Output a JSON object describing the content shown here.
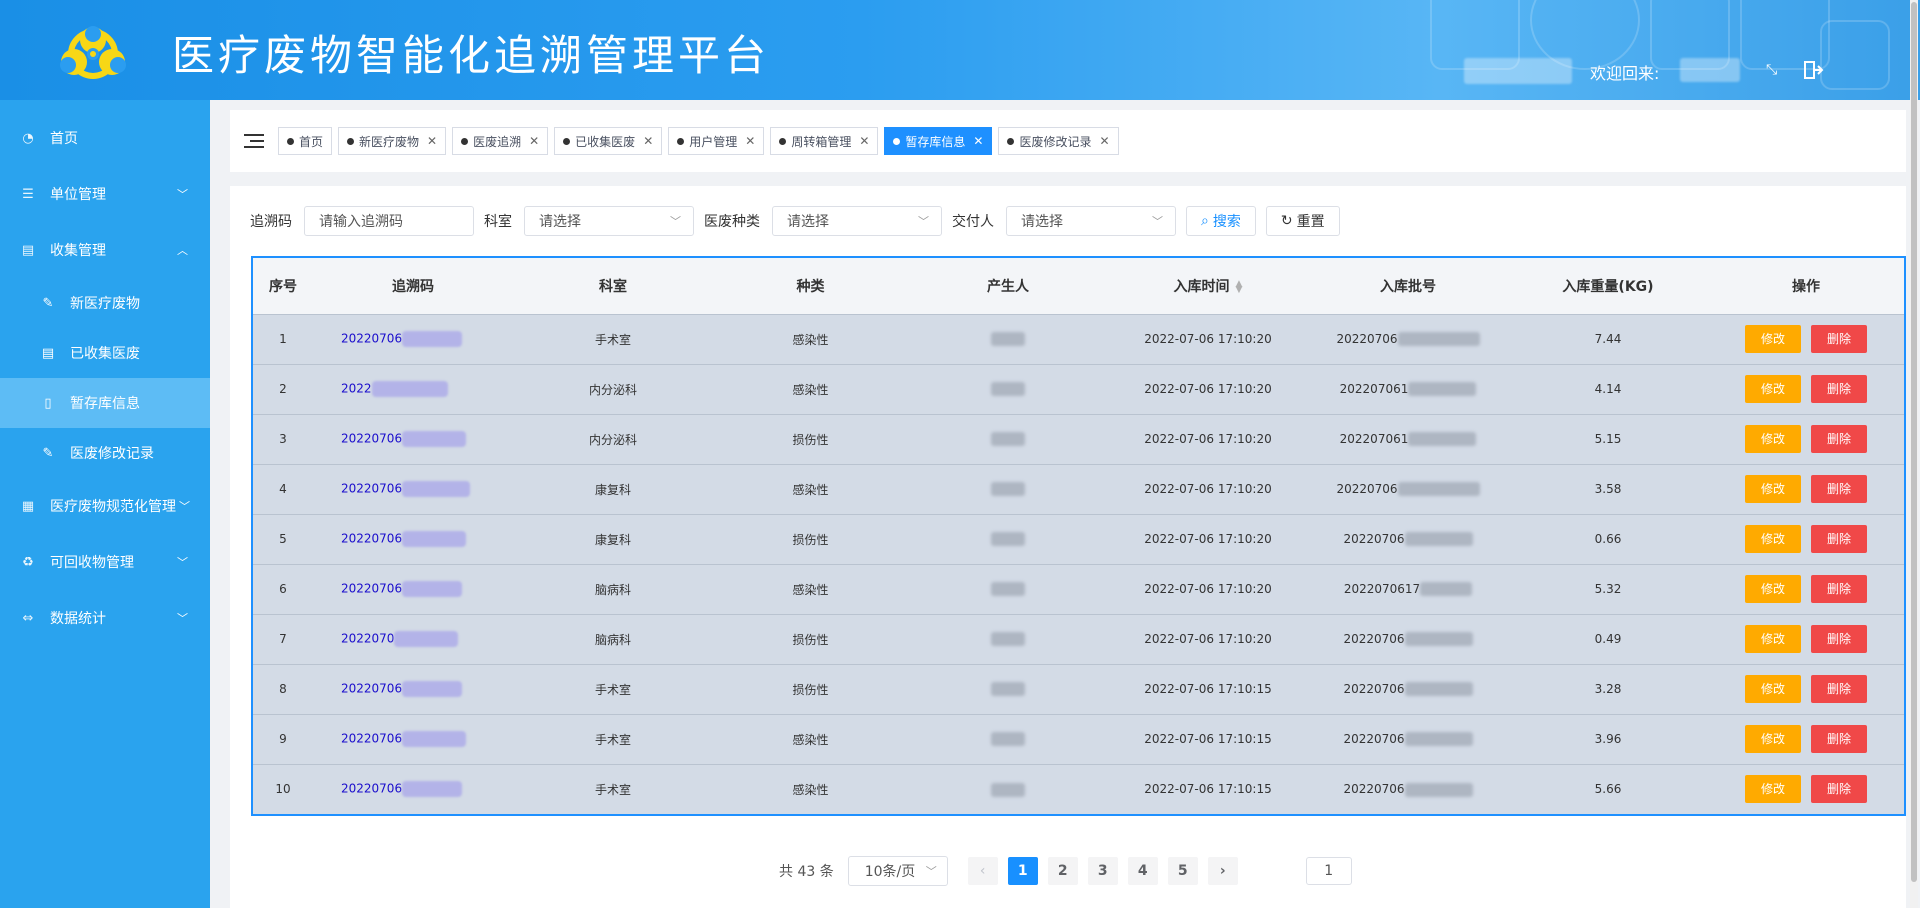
{
  "header": {
    "title": "医疗废物智能化追溯管理平台",
    "welcome": "欢迎回来:"
  },
  "sidebar": {
    "items": [
      {
        "label": "首页",
        "icon": "dashboard-icon"
      },
      {
        "label": "单位管理",
        "icon": "list-icon"
      },
      {
        "label": "收集管理",
        "icon": "box-icon"
      },
      {
        "label": "医疗废物规范化管理",
        "icon": "grid-icon"
      },
      {
        "label": "可回收物管理",
        "icon": "recycle-icon"
      },
      {
        "label": "数据统计",
        "icon": "chart-icon"
      }
    ],
    "sub_items": [
      {
        "label": "新医疗废物",
        "icon": "edit-icon"
      },
      {
        "label": "已收集医废",
        "icon": "box-icon"
      },
      {
        "label": "暂存库信息",
        "icon": "book-icon"
      },
      {
        "label": "医废修改记录",
        "icon": "edit-icon"
      }
    ]
  },
  "tabs": [
    {
      "label": "首页",
      "closable": false
    },
    {
      "label": "新医疗废物",
      "closable": true
    },
    {
      "label": "医废追溯",
      "closable": true
    },
    {
      "label": "已收集医废",
      "closable": true
    },
    {
      "label": "用户管理",
      "closable": true
    },
    {
      "label": "周转箱管理",
      "closable": true
    },
    {
      "label": "暂存库信息",
      "closable": true,
      "active": true
    },
    {
      "label": "医废修改记录",
      "closable": true
    }
  ],
  "filters": {
    "trace_label": "追溯码",
    "trace_placeholder": "请输入追溯码",
    "dept_label": "科室",
    "dept_value": "请选择",
    "type_label": "医废种类",
    "type_value": "请选择",
    "deliverer_label": "交付人",
    "deliverer_value": "请选择",
    "search_label": "搜索",
    "reset_label": "重置"
  },
  "table": {
    "headers": [
      "序号",
      "追溯码",
      "科室",
      "种类",
      "产生人",
      "入库时间",
      "入库批号",
      "入库重量(KG)",
      "操作"
    ],
    "edit_label": "修改",
    "delete_label": "删除",
    "rows": [
      {
        "no": "1",
        "code": "20220706",
        "dept": "手术室",
        "type": "感染性",
        "time": "2022-07-06 17:10:20",
        "batch": "20220706",
        "weight": "7.44"
      },
      {
        "no": "2",
        "code": "2022",
        "dept": "内分泌科",
        "type": "感染性",
        "time": "2022-07-06 17:10:20",
        "batch": "202207061",
        "weight": "4.14"
      },
      {
        "no": "3",
        "code": "20220706",
        "dept": "内分泌科",
        "type": "损伤性",
        "time": "2022-07-06 17:10:20",
        "batch": "202207061",
        "weight": "5.15"
      },
      {
        "no": "4",
        "code": "20220706",
        "dept": "康复科",
        "type": "感染性",
        "time": "2022-07-06 17:10:20",
        "batch": "20220706",
        "weight": "3.58"
      },
      {
        "no": "5",
        "code": "20220706",
        "dept": "康复科",
        "type": "损伤性",
        "time": "2022-07-06 17:10:20",
        "batch": "20220706",
        "weight": "0.66"
      },
      {
        "no": "6",
        "code": "20220706",
        "dept": "脑病科",
        "type": "感染性",
        "time": "2022-07-06 17:10:20",
        "batch": "2022070617",
        "weight": "5.32"
      },
      {
        "no": "7",
        "code": "2022070",
        "dept": "脑病科",
        "type": "损伤性",
        "time": "2022-07-06 17:10:20",
        "batch": "20220706",
        "weight": "0.49"
      },
      {
        "no": "8",
        "code": "20220706",
        "dept": "手术室",
        "type": "损伤性",
        "time": "2022-07-06 17:10:15",
        "batch": "20220706",
        "weight": "3.28"
      },
      {
        "no": "9",
        "code": "20220706",
        "dept": "手术室",
        "type": "感染性",
        "time": "2022-07-06 17:10:15",
        "batch": "20220706",
        "weight": "3.96"
      },
      {
        "no": "10",
        "code": "20220706",
        "dept": "手术室",
        "type": "感染性",
        "time": "2022-07-06 17:10:15",
        "batch": "20220706",
        "weight": "5.66"
      }
    ]
  },
  "pagination": {
    "total": "共 43 条",
    "page_size": "10条/页",
    "pages": [
      "1",
      "2",
      "3",
      "4",
      "5"
    ],
    "current": "1",
    "jump_value": "1"
  }
}
